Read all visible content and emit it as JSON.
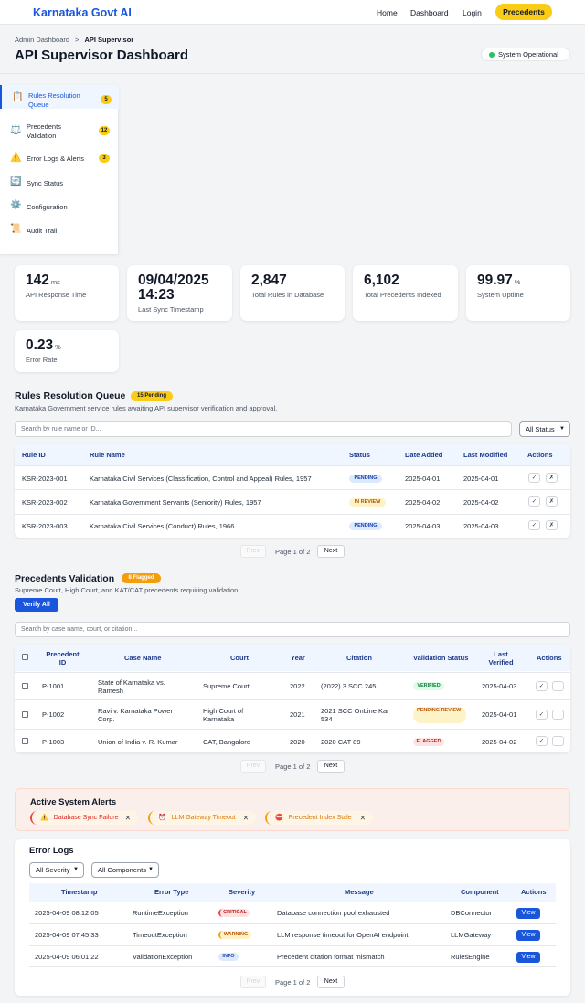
{
  "nav": {
    "brand": "Karnataka Govt AI",
    "home": "Home",
    "dashboard": "Dashboard",
    "login": "Login",
    "cta": "Precedents"
  },
  "header": {
    "breadcrumb_root": "Admin Dashboard",
    "breadcrumb_sep": ">",
    "breadcrumb_current": "API Supervisor",
    "title": "API Supervisor Dashboard",
    "status": "System Operational"
  },
  "sidebar": {
    "items": [
      {
        "label": "Rules Resolution Queue",
        "icon": "clipboard-icon",
        "glyph": "📋",
        "badge": "5"
      },
      {
        "label": "Precedents Validation",
        "icon": "scales-icon",
        "glyph": "⚖️",
        "badge": "12"
      },
      {
        "label": "Error Logs & Alerts",
        "icon": "warning-icon",
        "glyph": "⚠️",
        "badge": "3"
      },
      {
        "label": "Sync Status",
        "icon": "sync-icon",
        "glyph": "🔄",
        "badge": ""
      },
      {
        "label": "Configuration",
        "icon": "gear-icon",
        "glyph": "⚙️",
        "badge": ""
      },
      {
        "label": "Audit Trail",
        "icon": "scroll-icon",
        "glyph": "📜",
        "badge": ""
      }
    ]
  },
  "stats": [
    {
      "value": "142",
      "unit": "ms",
      "label": "API Response Time"
    },
    {
      "value": "09/04/2025 14:23",
      "unit": "",
      "label": "Last Sync Timestamp"
    },
    {
      "value": "2,847",
      "unit": "",
      "label": "Total Rules in Database"
    },
    {
      "value": "6,102",
      "unit": "",
      "label": "Total Precedents Indexed"
    },
    {
      "value": "99.97",
      "unit": "%",
      "label": "System Uptime"
    },
    {
      "value": "0.23",
      "unit": "%",
      "label": "Error Rate"
    }
  ],
  "rules": {
    "title": "Rules Resolution Queue",
    "badge": "15 Pending",
    "desc": "Karnataka Government service rules awaiting API supervisor verification and approval.",
    "search_placeholder": "Search by rule name or ID...",
    "filter": "All Status",
    "headers": [
      "Rule ID",
      "Rule Name",
      "Status",
      "Date Added",
      "Last Modified",
      "Actions"
    ],
    "rows": [
      {
        "id": "KSR-2023-001",
        "name": "Karnataka Civil Services (Classification, Control and Appeal) Rules, 1957",
        "status": "PENDING",
        "added": "2025-04-01",
        "modified": "2025-04-01"
      },
      {
        "id": "KSR-2023-002",
        "name": "Karnataka Government Servants (Seniority) Rules, 1957",
        "status": "IN REVIEW",
        "added": "2025-04-02",
        "modified": "2025-04-02"
      },
      {
        "id": "KSR-2023-003",
        "name": "Karnataka Civil Services (Conduct) Rules, 1966",
        "status": "PENDING",
        "added": "2025-04-03",
        "modified": "2025-04-03"
      }
    ],
    "approve_glyph": "✓",
    "reject_glyph": "✗",
    "prev": "Prev",
    "page": "Page 1 of 2",
    "next": "Next"
  },
  "precedents": {
    "title": "Precedents Validation",
    "badge": "8 Flagged",
    "desc": "Supreme Court, High Court, and KAT/CAT precedents requiring validation.",
    "verify_all": "Verify All",
    "search_placeholder": "Search by case name, court, or citation...",
    "headers": [
      "Precedent ID",
      "Case Name",
      "Court",
      "Year",
      "Citation",
      "Validation Status",
      "Last Verified",
      "Actions"
    ],
    "rows": [
      {
        "id": "P-1001",
        "name": "State of Karnataka vs. Ramesh",
        "court": "Supreme Court",
        "year": "2022",
        "citation": "(2022) 3 SCC 245",
        "status": "VERIFIED",
        "verified": "2025-04-03"
      },
      {
        "id": "P-1002",
        "name": "Ravi v. Karnataka Power Corp.",
        "court": "High Court of Karnataka",
        "year": "2021",
        "citation": "2021 SCC OnLine Kar 534",
        "status": "PENDING REVIEW",
        "verified": "2025-04-01"
      },
      {
        "id": "P-1003",
        "name": "Union of India v. R. Kumar",
        "court": "CAT, Bangalore",
        "year": "2020",
        "citation": "2020 CAT 89",
        "status": "FLAGGED",
        "verified": "2025-04-02"
      }
    ],
    "check_glyph": "✓",
    "flag_glyph": "!",
    "prev": "Prev",
    "page": "Page 1 of 2",
    "next": "Next"
  },
  "alerts": {
    "title": "Active System Alerts",
    "items": [
      {
        "label": "Database Sync Failure",
        "icon": "warning-icon",
        "glyph": "⚠️"
      },
      {
        "label": "LLM Gateway Timeout",
        "icon": "clock-icon",
        "glyph": "⏰"
      },
      {
        "label": "Precedent Index Stale",
        "icon": "no-entry-icon",
        "glyph": "⛔"
      }
    ],
    "close_glyph": "✕"
  },
  "errors": {
    "title": "Error Logs",
    "severity_filter": "All Severity",
    "component_filter": "All Components",
    "headers": [
      "Timestamp",
      "Error Type",
      "Severity",
      "Message",
      "Component",
      "Actions"
    ],
    "rows": [
      {
        "time": "2025-04-09 08:12:05",
        "type": "RuntimeException",
        "severity": "CRITICAL",
        "message": "Database connection pool exhausted",
        "component": "DBConnector"
      },
      {
        "time": "2025-04-09 07:45:33",
        "type": "TimeoutException",
        "severity": "WARNING",
        "message": "LLM response timeout for OpenAI endpoint",
        "component": "LLMGateway"
      },
      {
        "time": "2025-04-09 06:01:22",
        "type": "ValidationException",
        "severity": "INFO",
        "message": "Precedent citation format mismatch",
        "component": "RulesEngine"
      }
    ],
    "view": "View",
    "prev": "Prev",
    "page": "Page 1 of 2",
    "next": "Next"
  }
}
